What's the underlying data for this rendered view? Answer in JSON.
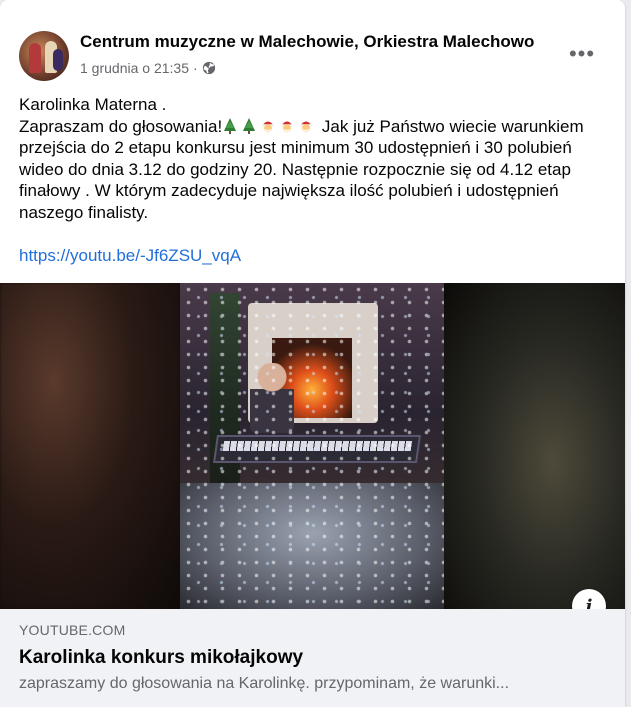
{
  "post": {
    "page_name": "Centrum muzyczne w Malechowie, Orkiestra Malechowo",
    "timestamp": "1 grudnia o 21:35",
    "separator": "·",
    "visibility_icon": "globe-icon",
    "more_label": "•••",
    "text_line1": "Karolinka Materna .",
    "text_line2_start": "Zapraszam do głosowania!",
    "text_line2_emojis": [
      "christmas-tree",
      "christmas-tree",
      "santa",
      "santa",
      "santa"
    ],
    "text_line2_end": " Jak już Państwo wiecie",
    "text_rest": "warunkiem przejścia do 2 etapu konkursu jest minimum 30 udostępnień i 30 polubień wideo do dnia 3.12 do godziny 20. Następnie rozpocznie się od 4.12 etap finałowy . W którym zadecyduje największa ilość polubień i udostępnień naszego finalisty.",
    "link": "https://youtu.be/-Jf6ZSU_vqA"
  },
  "preview": {
    "info_label": "i",
    "domain": "YOUTUBE.COM",
    "title": "Karolinka konkurs mikołajkowy",
    "description": "zapraszamy do głosowania na Karolinkę. przypominam, że warunki..."
  },
  "colors": {
    "link": "#216fdb",
    "secondary_text": "#65676b",
    "preview_bg": "#f0f2f5"
  }
}
